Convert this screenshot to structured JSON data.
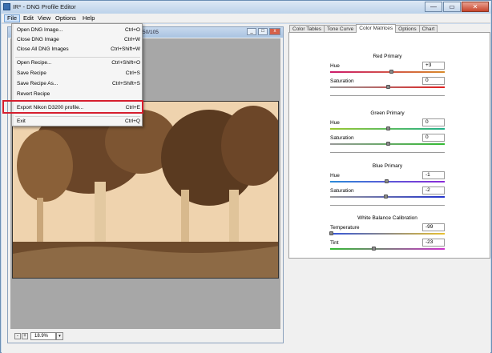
{
  "app": {
    "title": "IR* - DNG Profile Editor",
    "window_controls": {
      "minimize": "—",
      "maximize": "▭",
      "close": "✕"
    }
  },
  "menubar": {
    "items": [
      "File",
      "Edit",
      "View",
      "Options",
      "Help"
    ],
    "active": "File"
  },
  "file_menu": {
    "items": [
      {
        "label": "Open DNG Image...",
        "shortcut": "Ctrl+O"
      },
      {
        "label": "Close DNG Image",
        "shortcut": "Ctrl+W"
      },
      {
        "label": "Close All DNG Images",
        "shortcut": "Ctrl+Shift+W"
      },
      {
        "label": "Open Recipe...",
        "shortcut": "Ctrl+Shift+O"
      },
      {
        "label": "Save Recipe",
        "shortcut": "Ctrl+S"
      },
      {
        "label": "Save Recipe As...",
        "shortcut": "Ctrl+Shift+S"
      },
      {
        "label": "Revert Recipe",
        "shortcut": ""
      },
      {
        "label": "Export Nikon D3200 profile...",
        "shortcut": "Ctrl+E"
      },
      {
        "label": "Exit",
        "shortcut": "Ctrl+Q"
      }
    ],
    "highlighted": "Export Nikon D3200 profile..."
  },
  "image_window": {
    "title_fragment": "50/105",
    "zoom": "18.9%",
    "controls": {
      "minimize": "_",
      "maximize": "□",
      "close": "x"
    },
    "nav_prev": "-",
    "nav_next": "+",
    "zoom_dropdown": "▾"
  },
  "tabs": {
    "items": [
      "Color Tables",
      "Tone Curve",
      "Color Matrices",
      "Options",
      "Chart"
    ],
    "selected": "Color Matrices"
  },
  "color_matrices": {
    "groups": [
      {
        "title": "Red Primary",
        "rows": [
          {
            "label": "Hue",
            "value": "+3",
            "position": 0.53,
            "gradient": [
              "#cc1a6a",
              "#d88a2a"
            ]
          },
          {
            "label": "Saturation",
            "value": "0",
            "position": 0.5,
            "gradient": [
              "#999999",
              "#e02020"
            ]
          }
        ]
      },
      {
        "title": "Green Primary",
        "rows": [
          {
            "label": "Hue",
            "value": "0",
            "position": 0.5,
            "gradient": [
              "#9ac832",
              "#22b08a"
            ]
          },
          {
            "label": "Saturation",
            "value": "0",
            "position": 0.5,
            "gradient": [
              "#999999",
              "#33bb33"
            ]
          }
        ]
      },
      {
        "title": "Blue Primary",
        "rows": [
          {
            "label": "Hue",
            "value": "-1",
            "position": 0.49,
            "gradient": [
              "#2a8ad8",
              "#8a2ad8"
            ]
          },
          {
            "label": "Saturation",
            "value": "-2",
            "position": 0.48,
            "gradient": [
              "#999999",
              "#2233cc"
            ]
          }
        ]
      },
      {
        "title": "White Balance Calibration",
        "rows": [
          {
            "label": "Temperature",
            "value": "-99",
            "position": 0.01,
            "gradient": [
              "#3355dd",
              "#e8c030"
            ]
          },
          {
            "label": "Tint",
            "value": "-23",
            "position": 0.38,
            "gradient": [
              "#33bb33",
              "#cc33cc"
            ]
          }
        ]
      }
    ]
  }
}
